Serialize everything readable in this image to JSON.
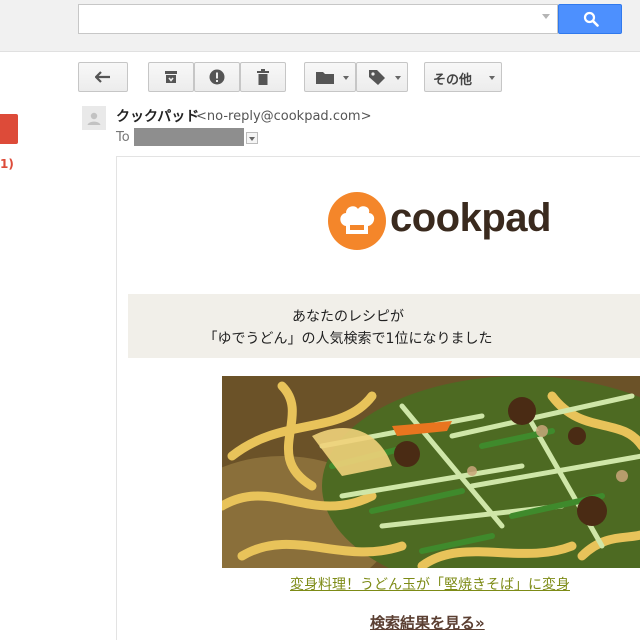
{
  "search": {
    "value": "",
    "placeholder": ""
  },
  "toolbar": {
    "buttons": [
      {
        "name": "back",
        "icon": "back-arrow-icon"
      },
      {
        "name": "archive",
        "icon": "archive-icon"
      },
      {
        "name": "report-spam",
        "icon": "report-spam-icon"
      },
      {
        "name": "delete",
        "icon": "trash-icon"
      },
      {
        "name": "move-to",
        "icon": "folder-icon"
      },
      {
        "name": "labels",
        "icon": "label-icon"
      }
    ],
    "more_label": "その他"
  },
  "sidebar": {
    "inbox_count": "1)"
  },
  "message": {
    "sender_name": "クックパッド",
    "sender_email": "<no-reply@cookpad.com>",
    "to_label": "To"
  },
  "email": {
    "logo_text": "cookpad",
    "notice_line1": "あなたのレシピが",
    "notice_line2": "「ゆでうどん」の人気検索で1位になりました",
    "recipe_link": "変身料理！うどん玉が「堅焼きそば」に変身",
    "results_link": "検索結果を見る»"
  },
  "colors": {
    "search_button": "#4d90fe",
    "compose": "#dd4b39",
    "logo_orange": "#f4862a",
    "logo_text": "#3a2a1e",
    "recipe_link": "#7d8b16",
    "results_link": "#5b3f32",
    "notice_bg": "#f1efe9"
  }
}
